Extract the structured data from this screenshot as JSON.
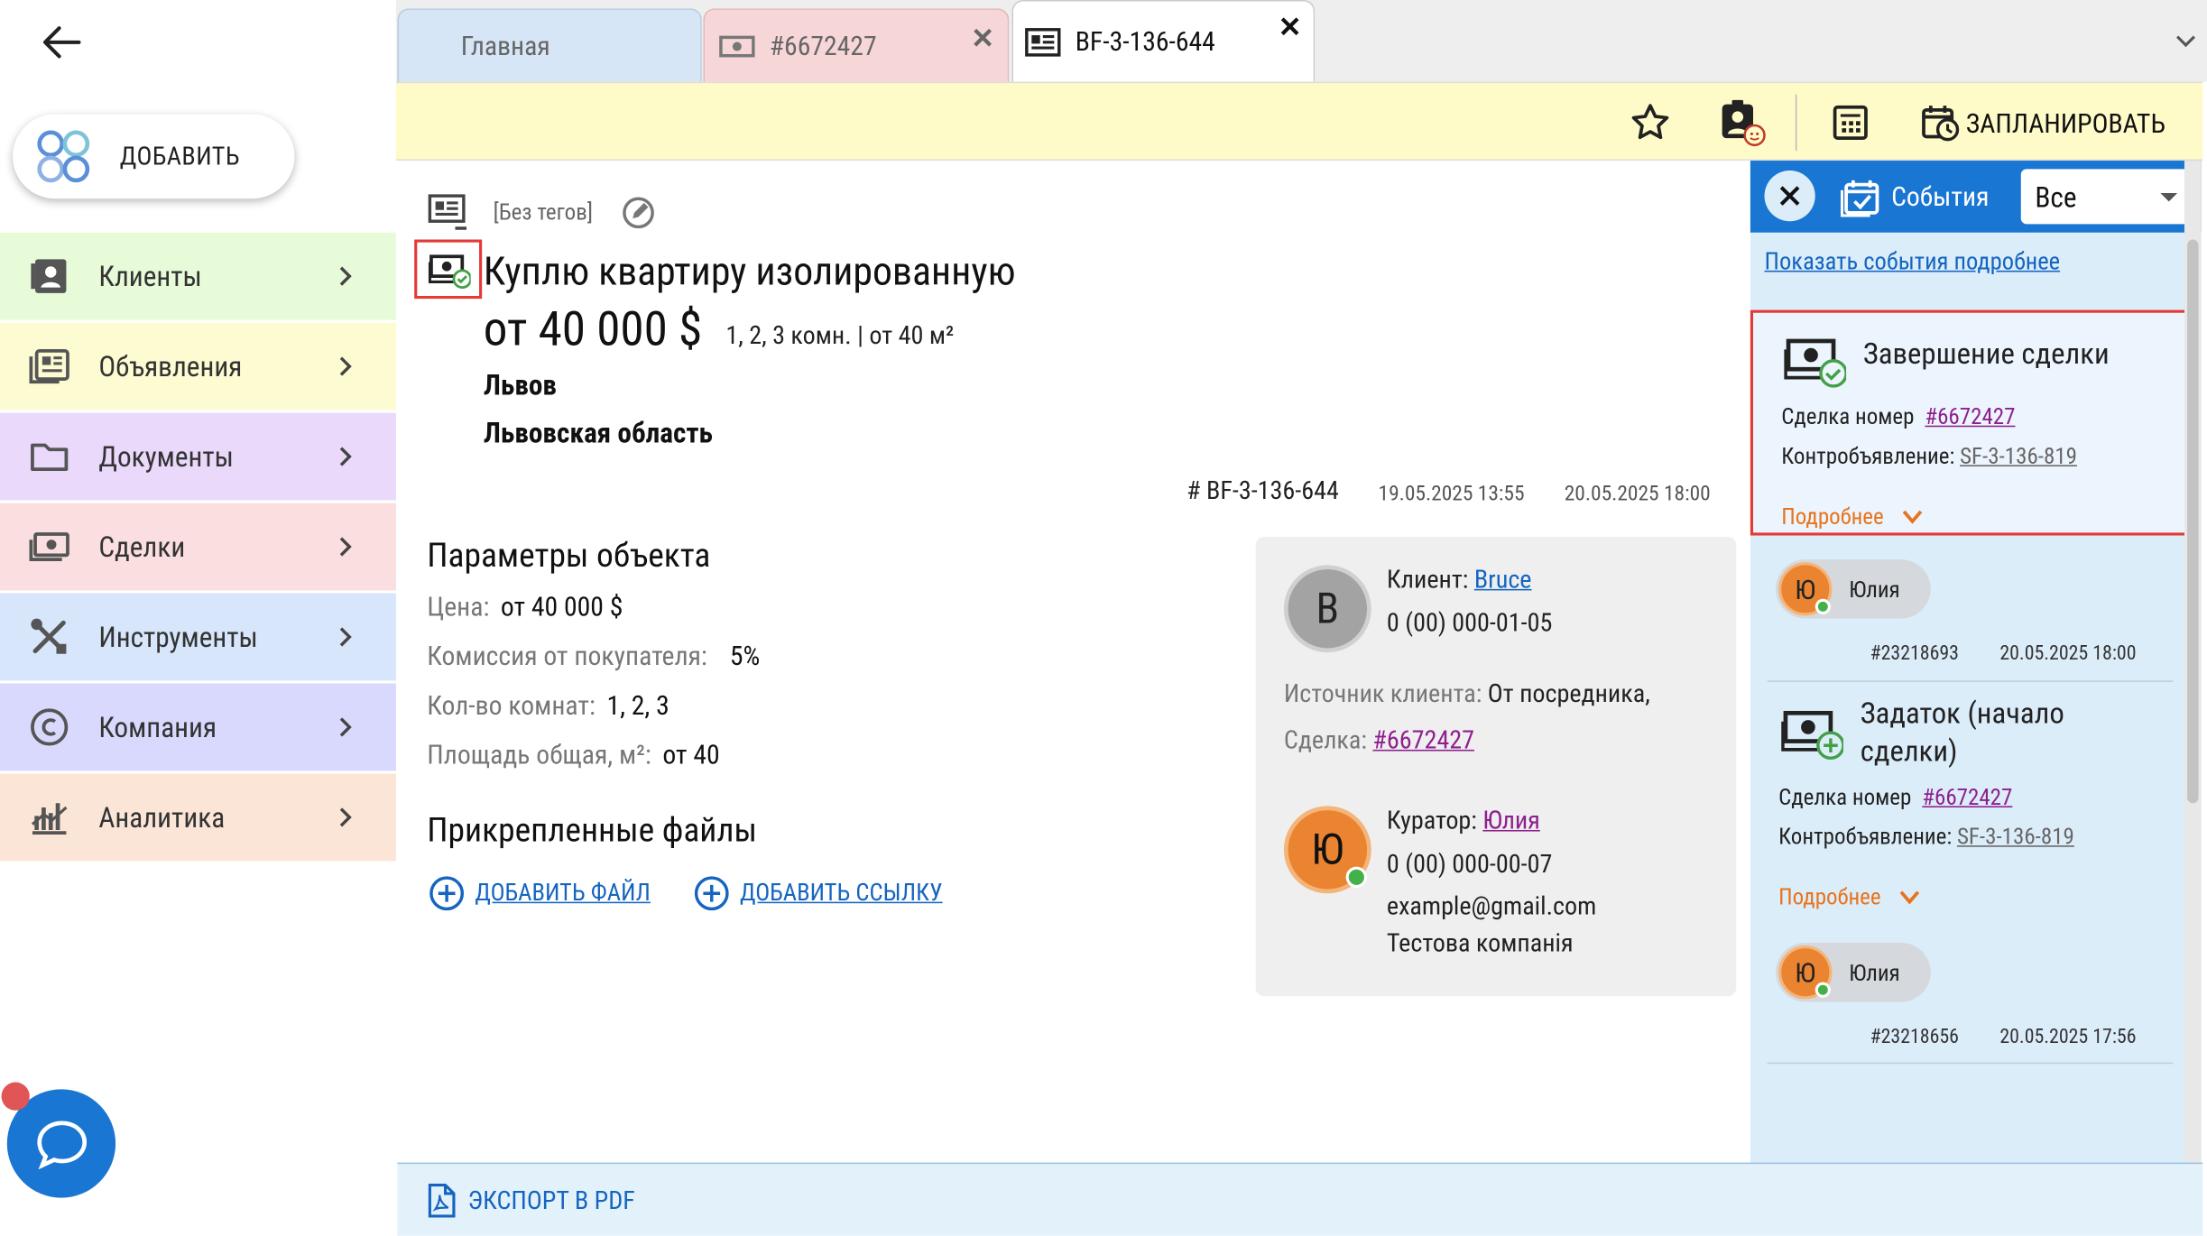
{
  "sidebar": {
    "add_label": "ДОБАВИТЬ",
    "items": [
      {
        "label": "Клиенты",
        "icon": "clients-icon",
        "bg": "#e7fbd9"
      },
      {
        "label": "Объявления",
        "icon": "listings-icon",
        "bg": "#fdfbd2"
      },
      {
        "label": "Документы",
        "icon": "folder-icon",
        "bg": "#ead9fb"
      },
      {
        "label": "Сделки",
        "icon": "deals-icon",
        "bg": "#fbdedf"
      },
      {
        "label": "Инструменты",
        "icon": "tools-icon",
        "bg": "#d7e6fb"
      },
      {
        "label": "Компания",
        "icon": "company-icon",
        "bg": "#d8d9fc"
      },
      {
        "label": "Аналитика",
        "icon": "analytics-icon",
        "bg": "#fbe5d7"
      }
    ]
  },
  "tabs": [
    {
      "label": "Главная"
    },
    {
      "label": "#6672427"
    },
    {
      "label": "BF-3-136-644"
    }
  ],
  "toolbar": {
    "schedule_label": "ЗАПЛАНИРОВАТЬ"
  },
  "listing": {
    "tags": "[Без тегов]",
    "title": "Куплю квартиру изолированную",
    "price": "от 40 000 $",
    "summary": "1, 2, 3 комн. | от 40 м²",
    "city": "Львов",
    "region": "Львовская область",
    "id": "# BF-3-136-644",
    "created": "19.05.2025 13:55",
    "updated": "20.05.2025 18:00"
  },
  "params": {
    "heading": "Параметры объекта",
    "rows": [
      {
        "label": "Цена:",
        "value": "от 40 000 $"
      },
      {
        "label": "Комиссия от покупателя:",
        "value": "5%"
      },
      {
        "label": "Кол-во комнат:",
        "value": "1, 2, 3"
      },
      {
        "label": "Площадь общая, м²:",
        "value": "от 40"
      }
    ]
  },
  "files": {
    "heading": "Прикрепленные файлы",
    "add_file": "ДОБАВИТЬ ФАЙЛ",
    "add_link": "ДОБАВИТЬ ССЫЛКУ"
  },
  "client_card": {
    "client_label": "Клиент:",
    "client_name": "Bruce",
    "client_initial": "B",
    "client_phone": "0 (00) 000-01-05",
    "source_label": "Источник клиента:",
    "source_value": "От посредника,",
    "deal_label": "Сделка:",
    "deal_value": "#6672427",
    "curator_label": "Куратор:",
    "curator_name": "Юлия",
    "curator_initial": "Ю",
    "curator_phone": "0 (00) 000-00-07",
    "curator_email": "example@gmail.com",
    "curator_company": "Тестова компанія"
  },
  "events": {
    "header_label": "События",
    "filter_value": "Все",
    "show_more_link": "Показать события подробнее",
    "items": [
      {
        "title": "Завершение сделки",
        "deal_label": "Сделка номер",
        "deal_value": "#6672427",
        "counter_label": "Контробъявление:",
        "counter_value": "SF-3-136-819",
        "more": "Подробнее",
        "user_initial": "Ю",
        "user_name": "Юлия",
        "event_id": "#23218693",
        "datetime": "20.05.2025 18:00"
      },
      {
        "title": "Задаток (начало сделки)",
        "deal_label": "Сделка номер",
        "deal_value": "#6672427",
        "counter_label": "Контробъявление:",
        "counter_value": "SF-3-136-819",
        "more": "Подробнее",
        "user_initial": "Ю",
        "user_name": "Юлия",
        "event_id": "#23218656",
        "datetime": "20.05.2025 17:56"
      }
    ]
  },
  "footer": {
    "export_label": "ЭКСПОРТ В PDF"
  },
  "colors": {
    "accent": "#1976d2",
    "highlight": "#e53935",
    "orange": "#e8731c",
    "curator": "#ea8431",
    "online": "#43b049"
  }
}
